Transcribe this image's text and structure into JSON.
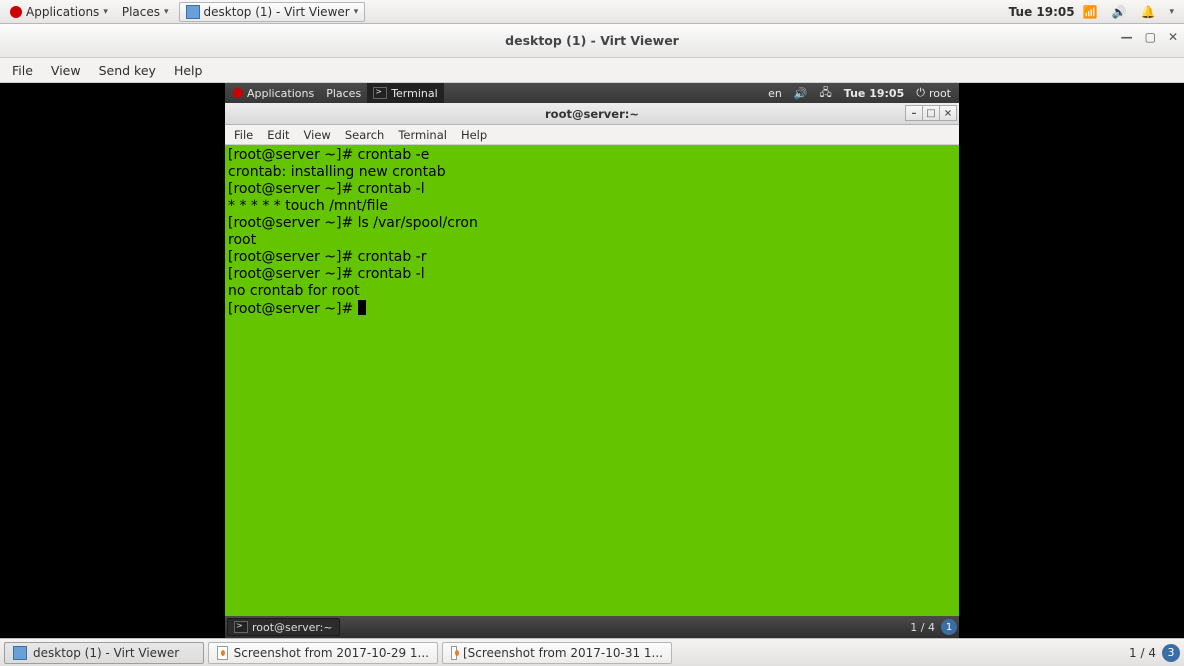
{
  "host_panel": {
    "applications": "Applications",
    "places": "Places",
    "task_title": "desktop (1) - Virt Viewer",
    "clock": "Tue 19:05"
  },
  "viewer": {
    "title": "desktop (1) - Virt Viewer",
    "menu": {
      "file": "File",
      "view": "View",
      "sendkey": "Send key",
      "help": "Help"
    }
  },
  "guest_panel": {
    "applications": "Applications",
    "places": "Places",
    "terminal": "Terminal",
    "lang": "en",
    "clock": "Tue 19:05",
    "user": "root"
  },
  "terminal": {
    "title": "root@server:~",
    "menu": {
      "file": "File",
      "edit": "Edit",
      "view": "View",
      "search": "Search",
      "terminal": "Terminal",
      "help": "Help"
    },
    "lines": [
      "[root@server ~]# crontab -e",
      "crontab: installing new crontab",
      "[root@server ~]# crontab -l",
      "* * * * * touch /mnt/file",
      "[root@server ~]# ls /var/spool/cron",
      "root",
      "[root@server ~]# crontab -r",
      "[root@server ~]# crontab -l",
      "no crontab for root",
      "[root@server ~]# "
    ]
  },
  "guest_bottom": {
    "task": "root@server:~",
    "workspace": "1 / 4",
    "ws_badge": "1"
  },
  "host_taskbar": {
    "tasks": [
      "desktop (1) - Virt Viewer",
      "Screenshot from 2017-10-29 1...",
      "[Screenshot from 2017-10-31 1..."
    ],
    "workspace": "1 / 4",
    "ws_badge": "3"
  }
}
